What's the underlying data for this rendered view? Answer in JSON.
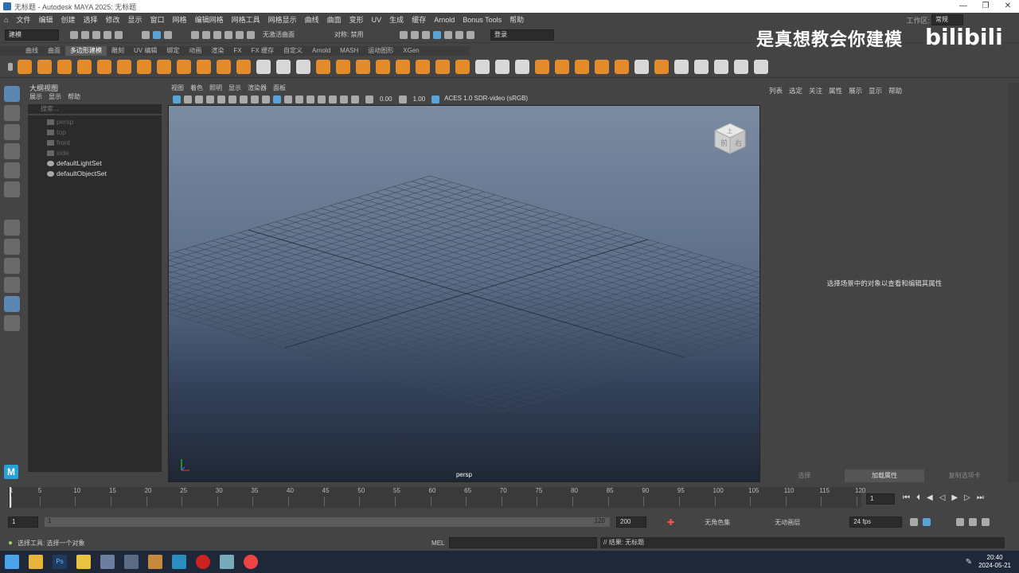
{
  "window": {
    "title": "无标题 - Autodesk MAYA 2025: 无标题"
  },
  "menu": [
    "文件",
    "编辑",
    "创建",
    "选择",
    "修改",
    "显示",
    "窗口",
    "网格",
    "编辑网格",
    "网格工具",
    "网格显示",
    "曲线",
    "曲面",
    "变形",
    "UV",
    "生成",
    "缓存",
    "Arnold",
    "Bonus Tools",
    "帮助"
  ],
  "workspace": {
    "label": "工作区:",
    "value": "常规"
  },
  "status": {
    "mode": "建模",
    "surface": "无激活曲面",
    "symmetry": "对称: 禁用",
    "login": "登录"
  },
  "shelf_tabs": [
    "曲线",
    "曲面",
    "多边形建模",
    "雕刻",
    "UV 编辑",
    "绑定",
    "动画",
    "渲染",
    "FX",
    "FX 缓存",
    "自定义",
    "Arnold",
    "MASH",
    "运动图形",
    "XGen"
  ],
  "shelf_active": "多边形建模",
  "outliner": {
    "title": "大纲视图",
    "menu": [
      "展示",
      "显示",
      "帮助"
    ],
    "search_placeholder": "搜索...",
    "items": [
      {
        "label": "persp",
        "kind": "camera"
      },
      {
        "label": "top",
        "kind": "camera"
      },
      {
        "label": "front",
        "kind": "camera"
      },
      {
        "label": "side",
        "kind": "camera"
      },
      {
        "label": "defaultLightSet",
        "kind": "set"
      },
      {
        "label": "defaultObjectSet",
        "kind": "set"
      }
    ]
  },
  "viewport": {
    "menu": [
      "视图",
      "着色",
      "照明",
      "显示",
      "渲染器",
      "面板"
    ],
    "exposure": "0.00",
    "gamma": "1.00",
    "colorspace": "ACES 1.0 SDR-video (sRGB)",
    "camera_label": "persp",
    "cube_labels": [
      "前",
      "右",
      "上"
    ]
  },
  "attribute_editor": {
    "menu": [
      "列表",
      "选定",
      "关注",
      "属性",
      "展示",
      "显示",
      "帮助"
    ],
    "message": "选择场景中的对象以查看和编辑其属性",
    "tabs": [
      "选择",
      "加载属性",
      "复制选项卡"
    ],
    "active_tab": "加载属性"
  },
  "timeline": {
    "ticks": [
      "1",
      "5",
      "10",
      "15",
      "20",
      "25",
      "30",
      "35",
      "40",
      "45",
      "50",
      "55",
      "60",
      "65",
      "70",
      "75",
      "80",
      "85",
      "90",
      "95",
      "100",
      "105",
      "110",
      "115",
      "120"
    ],
    "current": "1"
  },
  "range": {
    "start": "1",
    "inner_start": "1",
    "inner_end": "120",
    "end": "200",
    "character_set": "无角色集",
    "anim_layer": "无动画层",
    "fps": "24 fps"
  },
  "command": {
    "help": "选择工具: 选择一个对象",
    "lang": "MEL",
    "result": "// 结果: 无标题"
  },
  "taskbar": {
    "time": "20:40",
    "date": "2024-05-21"
  },
  "watermark": {
    "text": "是真想教会你建模",
    "logo": "bilibili"
  }
}
